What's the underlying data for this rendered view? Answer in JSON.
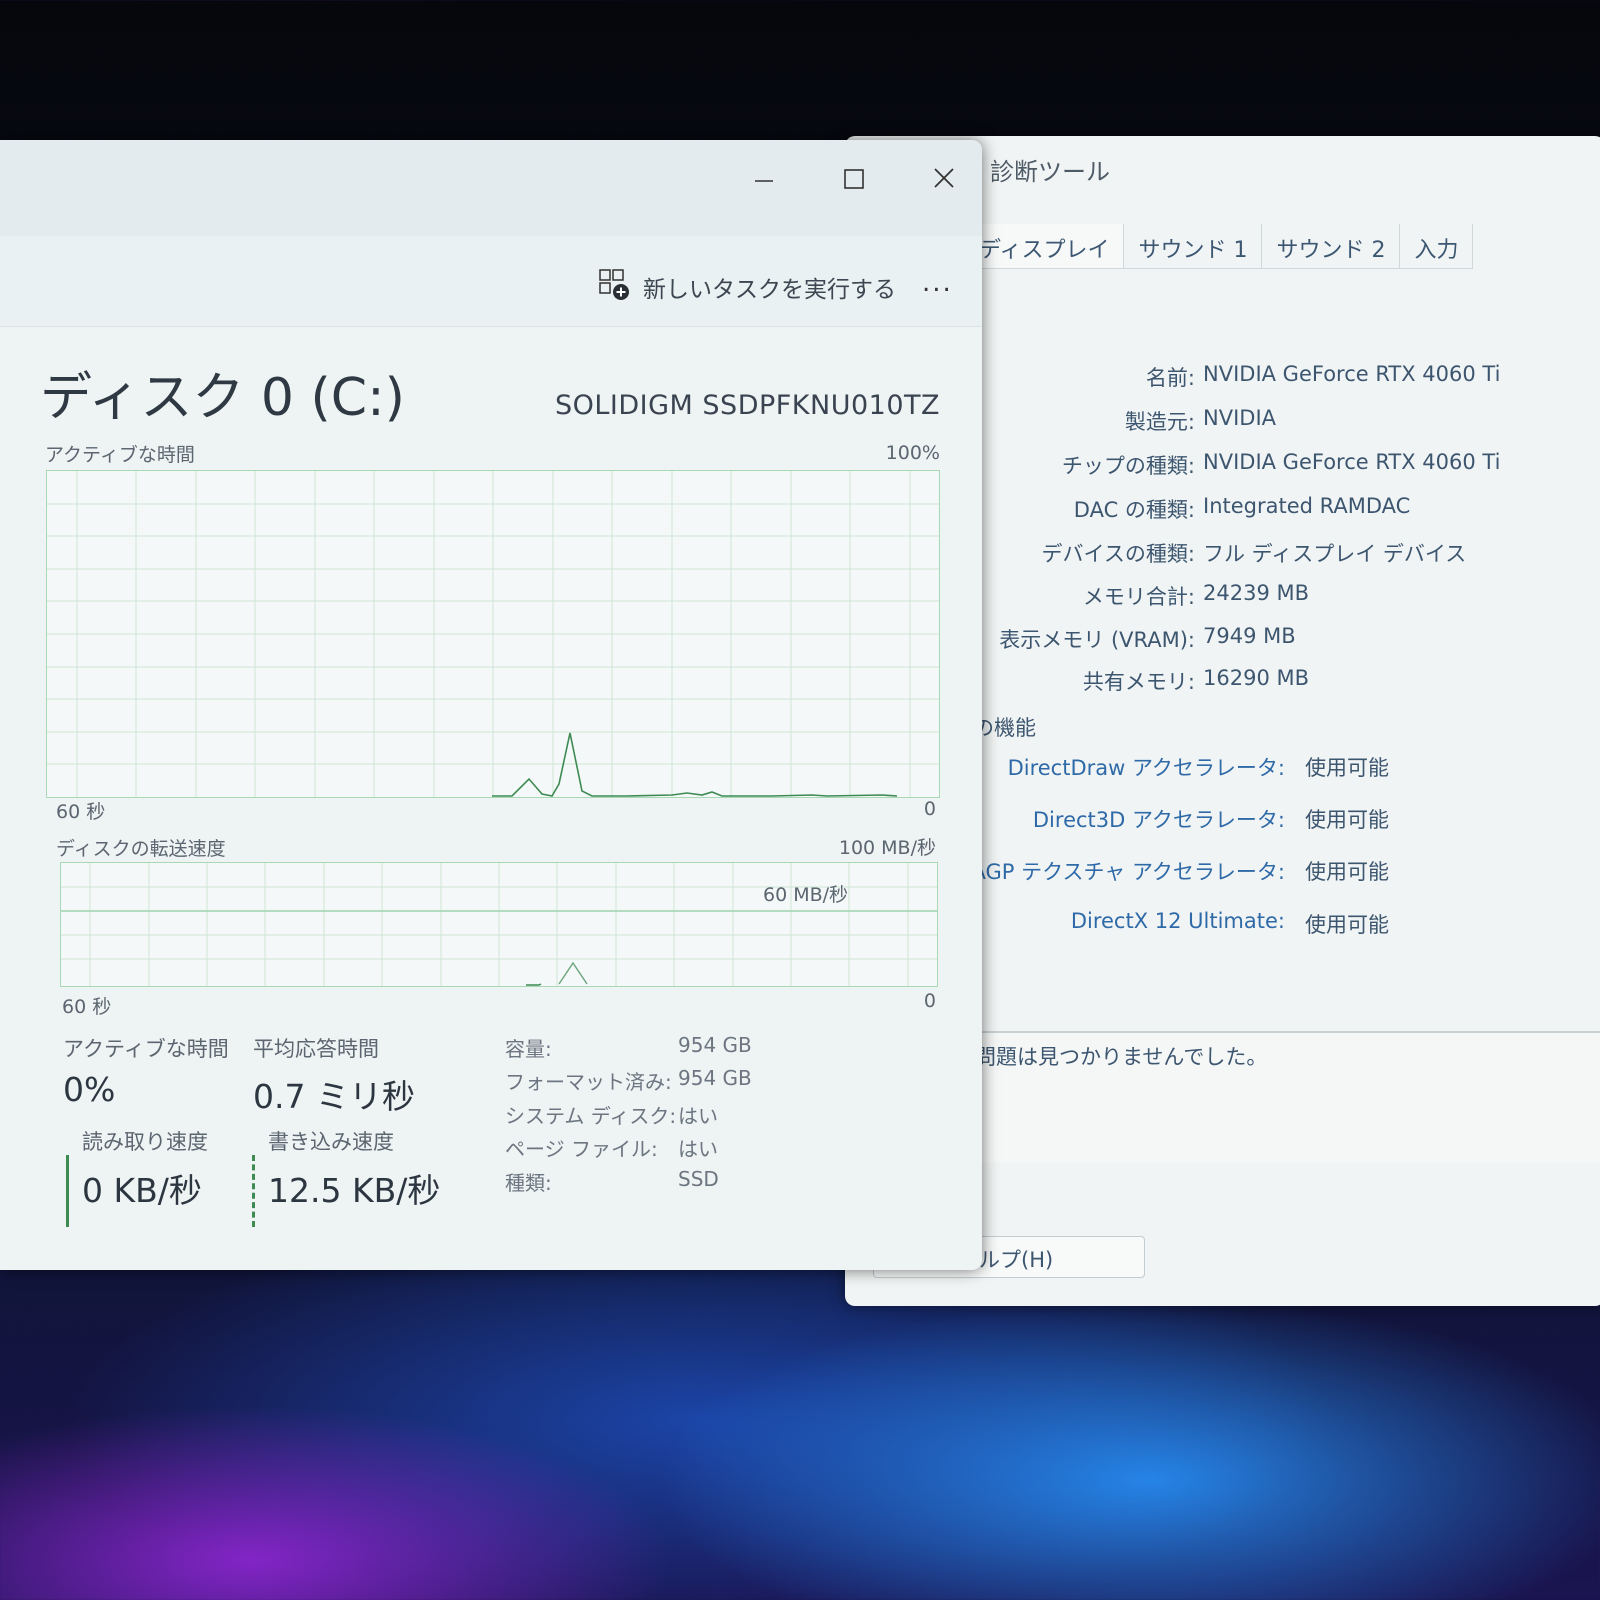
{
  "dxdiag": {
    "title": "診断ツール",
    "tabs": [
      "ディスプレイ",
      "サウンド 1",
      "サウンド 2",
      "入力"
    ],
    "device": [
      {
        "label": "名前:",
        "value": "NVIDIA GeForce RTX 4060 Ti"
      },
      {
        "label": "製造元:",
        "value": "NVIDIA"
      },
      {
        "label": "チップの種類:",
        "value": "NVIDIA GeForce RTX 4060 Ti"
      },
      {
        "label": "DAC の種類:",
        "value": "Integrated RAMDAC"
      },
      {
        "label": "デバイスの種類:",
        "value": "フル ディスプレイ デバイス"
      },
      {
        "label": "メモリ合計:",
        "value": "24239 MB"
      },
      {
        "label": "表示メモリ (VRAM):",
        "value": "7949 MB"
      },
      {
        "label": "共有メモリ:",
        "value": "16290 MB"
      }
    ],
    "features_header": "の機能",
    "features": [
      {
        "label": "DirectDraw アクセラレータ:",
        "value": "使用可能"
      },
      {
        "label": "Direct3D アクセラレータ:",
        "value": "使用可能"
      },
      {
        "label": "AGP テクスチャ アクセラレータ:",
        "value": "使用可能"
      },
      {
        "label": "DirectX 12 Ultimate:",
        "value": "使用可能"
      }
    ],
    "notes_text": "問題は見つかりませんでした。",
    "help_button": "ルプ(H)"
  },
  "taskmanager": {
    "run_task": "新しいタスクを実行する",
    "more": "...",
    "disk_title": "ディスク 0 (C:)",
    "disk_model": "SOLIDIGM SSDPFKNU010TZ",
    "active_graph": {
      "label": "アクティブな時間",
      "max": "100%",
      "left": "60 秒",
      "right": "0"
    },
    "transfer_graph": {
      "label": "ディスクの転送速度",
      "max": "100 MB/秒",
      "mid": "60 MB/秒",
      "left": "60 秒",
      "right": "0"
    },
    "stats": {
      "active_label": "アクティブな時間",
      "active_value": "0%",
      "avg_label": "平均応答時間",
      "avg_value": "0.7 ミリ秒",
      "read_label": "読み取り速度",
      "read_value": "0 KB/秒",
      "write_label": "書き込み速度",
      "write_value": "12.5 KB/秒"
    },
    "info": [
      {
        "key": "容量:",
        "value": "954 GB"
      },
      {
        "key": "フォーマット済み:",
        "value": "954 GB"
      },
      {
        "key": "システム ディスク:",
        "value": "はい"
      },
      {
        "key": "ページ ファイル:",
        "value": "はい"
      },
      {
        "key": "種類:",
        "value": "SSD"
      }
    ]
  },
  "colors": {
    "graph_line": "#3d8a52",
    "graph_border": "#a9d8b4",
    "link_blue": "#2f6aa8"
  }
}
